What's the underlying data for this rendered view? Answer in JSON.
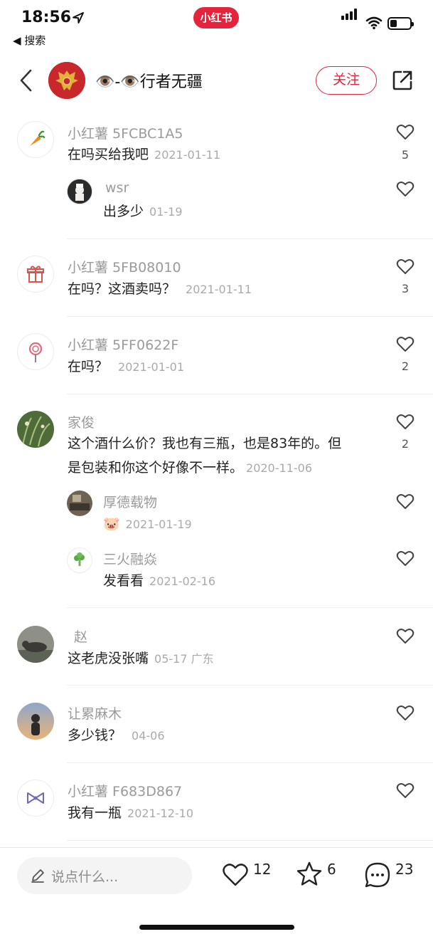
{
  "status_bar": {
    "time": "18:56",
    "app_pill": "小红书",
    "back_app": "◀ 搜索"
  },
  "header": {
    "title": "👁️-👁️行者无疆",
    "follow_label": "关注"
  },
  "colors": {
    "accent": "#e4243c",
    "muted": "#9a9a9a"
  },
  "comments": [
    {
      "name": "小红薯 5FCBC1A5",
      "text": "在吗买给我吧",
      "date": "2021-01-11",
      "likes": "5",
      "avatar_icon": "carrot-icon",
      "replies": [
        {
          "name": "wsr",
          "text": "出多少",
          "date": "01-19"
        }
      ]
    },
    {
      "name": "小红薯 5FB08010",
      "text": "在吗？这酒卖吗？",
      "date": "2021-01-11",
      "likes": "3",
      "avatar_icon": "gift-icon"
    },
    {
      "name": "小红薯 5FF0622F",
      "text": "在吗？",
      "date": "2021-01-01",
      "likes": "2",
      "avatar_icon": "lollipop-icon"
    },
    {
      "name": "家俊",
      "text_line1": "这个酒什么价？我也有三瓶，也是83年的。但",
      "text_line2": "是包装和你这个好像不一样。",
      "date": "2020-11-06",
      "likes": "2",
      "replies": [
        {
          "name": "厚德载物",
          "text": "🐷",
          "date": "2021-01-19"
        },
        {
          "name": "三火融焱",
          "text": "发看看",
          "date": "2021-02-16"
        }
      ]
    },
    {
      "name": "赵",
      "text": "这老虎没张嘴",
      "date": "05-17 广东"
    },
    {
      "name": "让累麻木",
      "text": "多少钱？",
      "date": "04-06"
    },
    {
      "name": "小红薯 F683D867",
      "text": "我有一瓶",
      "date": "2021-12-10",
      "avatar_icon": "bow-icon"
    }
  ],
  "bottom_bar": {
    "input_placeholder": "说点什么...",
    "likes": "12",
    "collects": "6",
    "comments": "23"
  }
}
